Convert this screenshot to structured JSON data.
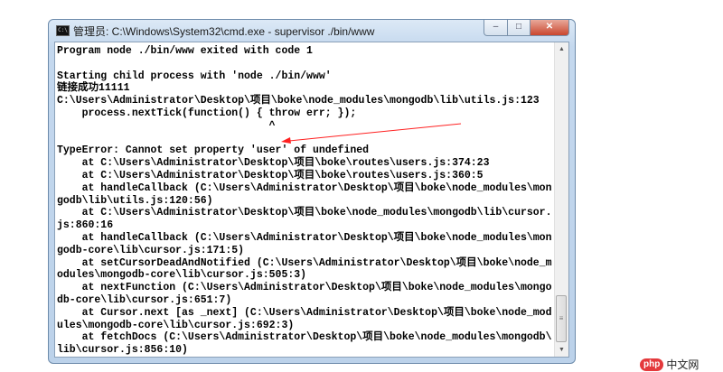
{
  "window": {
    "title": "管理员: C:\\Windows\\System32\\cmd.exe - supervisor  ./bin/www",
    "icon_label": "C:\\",
    "controls": {
      "minimize": "–",
      "maximize": "□",
      "close": "✕"
    }
  },
  "console": {
    "lines": [
      "Program node ./bin/www exited with code 1",
      "",
      "Starting child process with 'node ./bin/www'",
      "链接成功11111",
      "C:\\Users\\Administrator\\Desktop\\项目\\boke\\node_modules\\mongodb\\lib\\utils.js:123",
      "    process.nextTick(function() { throw err; });",
      "                                  ^",
      "",
      "TypeError: Cannot set property 'user' of undefined",
      "    at C:\\Users\\Administrator\\Desktop\\项目\\boke\\routes\\users.js:374:23",
      "    at C:\\Users\\Administrator\\Desktop\\项目\\boke\\routes\\users.js:360:5",
      "    at handleCallback (C:\\Users\\Administrator\\Desktop\\项目\\boke\\node_modules\\mon",
      "godb\\lib\\utils.js:120:56)",
      "    at C:\\Users\\Administrator\\Desktop\\项目\\boke\\node_modules\\mongodb\\lib\\cursor.",
      "js:860:16",
      "    at handleCallback (C:\\Users\\Administrator\\Desktop\\项目\\boke\\node_modules\\mon",
      "godb-core\\lib\\cursor.js:171:5)",
      "    at setCursorDeadAndNotified (C:\\Users\\Administrator\\Desktop\\项目\\boke\\node_m",
      "odules\\mongodb-core\\lib\\cursor.js:505:3)",
      "    at nextFunction (C:\\Users\\Administrator\\Desktop\\项目\\boke\\node_modules\\mongo",
      "db-core\\lib\\cursor.js:651:7)",
      "    at Cursor.next [as _next] (C:\\Users\\Administrator\\Desktop\\项目\\boke\\node_mod",
      "ules\\mongodb-core\\lib\\cursor.js:692:3)",
      "    at fetchDocs (C:\\Users\\Administrator\\Desktop\\项目\\boke\\node_modules\\mongodb\\",
      "lib\\cursor.js:856:10)"
    ]
  },
  "annotation": {
    "arrow_color": "#ff2020"
  },
  "watermark": {
    "php": "php",
    "text": "中文网"
  }
}
